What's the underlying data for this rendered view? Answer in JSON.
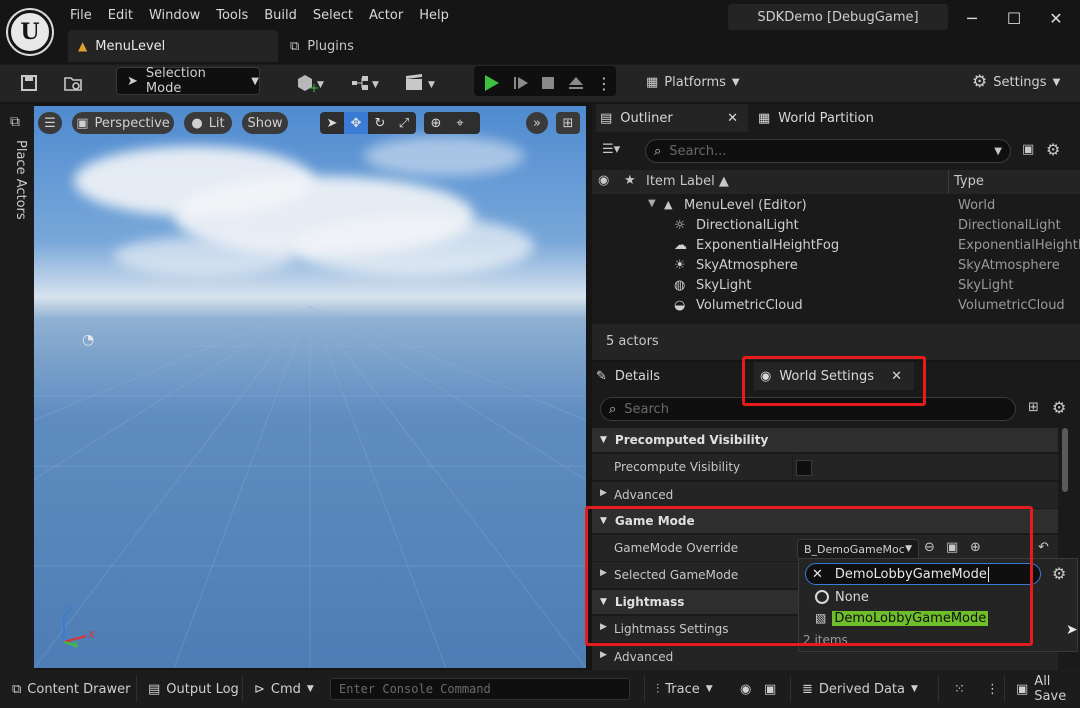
{
  "window": {
    "project_title": "SDKDemo [DebugGame]",
    "minimize": "─",
    "maximize": "☐",
    "close": "✕"
  },
  "menu": [
    "File",
    "Edit",
    "Window",
    "Tools",
    "Build",
    "Select",
    "Actor",
    "Help"
  ],
  "tabs": {
    "level": "MenuLevel",
    "plugins": "Plugins"
  },
  "toolbar": {
    "selection_mode": "Selection Mode",
    "platforms": "Platforms",
    "settings": "Settings"
  },
  "left_strip": {
    "place_actors": "Place Actors"
  },
  "viewport": {
    "perspective": "Perspective",
    "lit": "Lit",
    "show": "Show",
    "axis_x": "X",
    "axis_y": "Y",
    "axis_z": "Z"
  },
  "outliner": {
    "tab_label": "Outliner",
    "world_partition_label": "World Partition",
    "search_placeholder": "Search...",
    "col_item_label": "Item Label",
    "col_type": "Type",
    "root": {
      "label": "MenuLevel (Editor)",
      "type": "World"
    },
    "rows": [
      {
        "label": "DirectionalLight",
        "type": "DirectionalLight",
        "icon": "directional-light-icon"
      },
      {
        "label": "ExponentialHeightFog",
        "type": "ExponentialHeightFo",
        "icon": "fog-icon"
      },
      {
        "label": "SkyAtmosphere",
        "type": "SkyAtmosphere",
        "icon": "sky-atmosphere-icon"
      },
      {
        "label": "SkyLight",
        "type": "SkyLight",
        "icon": "sky-light-icon"
      },
      {
        "label": "VolumetricCloud",
        "type": "VolumetricCloud",
        "icon": "cloud-icon"
      }
    ],
    "actor_count": "5 actors"
  },
  "details": {
    "details_tab": "Details",
    "world_settings_tab": "World Settings",
    "search_placeholder": "Search",
    "categories": {
      "precomputed_visibility": "Precomputed Visibility",
      "game_mode": "Game Mode",
      "lightmass": "Lightmass"
    },
    "props": {
      "precompute_visibility": "Precompute Visibility",
      "advanced": "Advanced",
      "gamemode_override": "GameMode Override",
      "gamemode_override_value": "B_DemoGameMoc",
      "selected_gamemode": "Selected GameMode",
      "lightmass_settings": "Lightmass Settings",
      "advanced_bottom": "Advanced"
    }
  },
  "popup": {
    "search_value": "DemoLobbyGameMode",
    "items": [
      {
        "label": "None",
        "highlighted": false
      },
      {
        "label": "DemoLobbyGameMode",
        "highlighted": true
      }
    ],
    "count": "2 items"
  },
  "statusbar": {
    "content_drawer": "Content Drawer",
    "output_log": "Output Log",
    "cmd": "Cmd",
    "console_placeholder": "Enter Console Command",
    "trace": "Trace",
    "derived_data": "Derived Data",
    "all_saved": "All Save"
  },
  "colors": {
    "highlight_red": "#e61b1b",
    "match_green": "#6fbf2a",
    "play_green": "#3fbf3f",
    "accent_blue": "#3a7bd5"
  }
}
